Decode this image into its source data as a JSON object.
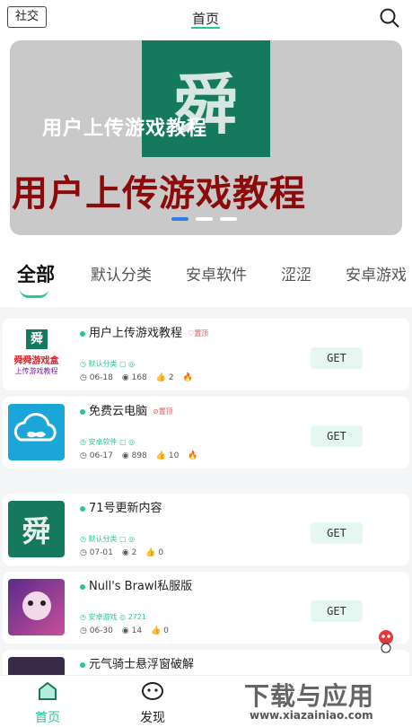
{
  "header": {
    "social_label": "社交",
    "title": "首页"
  },
  "banner": {
    "logo_glyph": "舜",
    "subtitle": "用户上传游戏教程",
    "main_text": "用户上传游戏教程"
  },
  "tabs": [
    {
      "label": "全部"
    },
    {
      "label": "默认分类"
    },
    {
      "label": "安卓软件"
    },
    {
      "label": "涩涩"
    },
    {
      "label": "安卓游戏"
    }
  ],
  "items": [
    {
      "title": "用户上传游戏教程",
      "tag": "♡置顶",
      "category": "默认分类",
      "date": "06-18",
      "views": "168",
      "likes": "2",
      "hot": "🔥",
      "get": "GET",
      "thumb_line1": "舜舜游戏盒",
      "thumb_line2": "上传游戏教程",
      "thumb_glyph": "舜"
    },
    {
      "title": "免费云电脑",
      "tag": "⊘置顶",
      "category": "安卓软件",
      "date": "06-17",
      "views": "898",
      "likes": "10",
      "hot": "🔥",
      "get": "GET"
    },
    {
      "title": "71号更新内容",
      "tag": "",
      "category": "默认分类",
      "date": "07-01",
      "views": "2",
      "likes": "0",
      "hot": "",
      "get": "GET",
      "thumb_glyph": "舜"
    },
    {
      "title": "Null's Brawl私服版",
      "tag": "",
      "category": "安卓游戏",
      "date": "06-30",
      "views": "14",
      "likes": "0",
      "hot": "",
      "get": "GET",
      "cat_extra": "2721"
    },
    {
      "title": "元气骑士悬浮窗破解",
      "tag": "",
      "category": "",
      "date": "",
      "views": "",
      "likes": "",
      "hot": "",
      "get": ""
    }
  ],
  "nav": {
    "home": "首页",
    "discover": "发现"
  },
  "watermark": {
    "text": "下载与应用",
    "url": "www.xiazainiao.com"
  },
  "colors": {
    "accent": "#2bc59a",
    "brand_green": "#157a5d",
    "banner_red": "#8c0a0a"
  }
}
